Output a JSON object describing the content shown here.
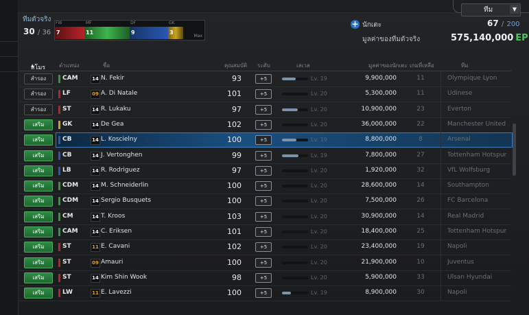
{
  "team_dropdown": {
    "label": "ทีม",
    "arrow": "▼"
  },
  "summary": {
    "title": "ทีมตัวจริง",
    "count": "30",
    "max": "/ 36"
  },
  "position_bar": {
    "headers": [
      "FW",
      "MF",
      "DF",
      "GK"
    ],
    "counts": [
      "7",
      "11",
      "9",
      "3"
    ],
    "max_label": "Max",
    "colors": {
      "FW": "#b8242a",
      "MF": "#2e9a3a",
      "DF": "#2a58b3",
      "GK": "#c9a21e"
    }
  },
  "player_add": {
    "icon": "plus-icon",
    "label": "นักเตะ"
  },
  "capacity": {
    "current": "67",
    "slash": "/",
    "max": "200"
  },
  "team_value": {
    "label": "มูลค่าของทีมตัวจริง",
    "amount": "575,140,000",
    "unit": "EP"
  },
  "columns": {
    "status": "สโมร",
    "sort_indicator": "▴",
    "position": "ตำแหน่ง",
    "name": "ชื่อ",
    "ovr": "คุณสมบัติ",
    "grade": "ระดับ",
    "level": "เลเวล",
    "value": "มูลค่าของนักเตะ",
    "games": "เกมที่เหลือ",
    "club": "ทีม"
  },
  "players": [
    {
      "status": "สำรอง",
      "type": "sub",
      "pos": "CAM",
      "pcolor": "#2e9a3a",
      "card": "14",
      "cardtype": "w",
      "name": "N. Fekir",
      "ovr": "93",
      "grade": "+5",
      "lvfill": 0.52,
      "lv": "Lv. 19",
      "value": "9,900,000",
      "games": "11",
      "club": "Olympique Lyon"
    },
    {
      "status": "สำรอง",
      "type": "sub",
      "pos": "LF",
      "pcolor": "#b8242a",
      "card": "09",
      "cardtype": "y",
      "name": "A. Di Natale",
      "ovr": "101",
      "grade": "+5",
      "lvfill": 0.0,
      "lv": "Lv. 20",
      "value": "5,300,000",
      "games": "11",
      "club": "Udinese"
    },
    {
      "status": "สำรอง",
      "type": "sub",
      "pos": "ST",
      "pcolor": "#b8242a",
      "card": "14",
      "cardtype": "w",
      "name": "R. Lukaku",
      "ovr": "97",
      "grade": "+5",
      "lvfill": 0.6,
      "lv": "Lv. 20",
      "value": "10,900,000",
      "games": "23",
      "club": "Everton"
    },
    {
      "status": "เสริม",
      "type": "start",
      "pos": "GK",
      "pcolor": "#c9a21e",
      "card": "14",
      "cardtype": "w",
      "name": "De Gea",
      "ovr": "102",
      "grade": "+5",
      "lvfill": 0.0,
      "lv": "Lv. 20",
      "value": "36,000,000",
      "games": "22",
      "club": "Manchester United"
    },
    {
      "status": "เสริม",
      "type": "start",
      "pos": "CB",
      "pcolor": "#2a58b3",
      "card": "14",
      "cardtype": "w",
      "name": "L. Koscielny",
      "ovr": "100",
      "grade": "+5",
      "lvfill": 0.55,
      "lv": "Lv. 19",
      "value": "8,800,000",
      "games": "8",
      "club": "Arsenal",
      "selected": true
    },
    {
      "status": "เสริม",
      "type": "start",
      "pos": "CB",
      "pcolor": "#2a58b3",
      "card": "14",
      "cardtype": "w",
      "name": "J. Vertonghen",
      "ovr": "99",
      "grade": "+5",
      "lvfill": 0.62,
      "lv": "Lv. 19",
      "value": "7,800,000",
      "games": "27",
      "club": "Tottenham Hotspur"
    },
    {
      "status": "เสริม",
      "type": "start",
      "pos": "LB",
      "pcolor": "#2a58b3",
      "card": "14",
      "cardtype": "w",
      "name": "R. Rodriguez",
      "ovr": "97",
      "grade": "+5",
      "lvfill": 0.0,
      "lv": "Lv. 20",
      "value": "1,920,000",
      "games": "32",
      "club": "VfL Wolfsburg"
    },
    {
      "status": "เสริม",
      "type": "start",
      "pos": "CDM",
      "pcolor": "#2e9a3a",
      "card": "14",
      "cardtype": "w",
      "name": "M. Schneiderlin",
      "ovr": "100",
      "grade": "+5",
      "lvfill": 0.0,
      "lv": "Lv. 20",
      "value": "28,600,000",
      "games": "14",
      "club": "Southampton"
    },
    {
      "status": "เสริม",
      "type": "start",
      "pos": "CDM",
      "pcolor": "#2e9a3a",
      "card": "14",
      "cardtype": "w",
      "name": "Sergio Busquets",
      "ovr": "100",
      "grade": "+5",
      "lvfill": 0.0,
      "lv": "Lv. 20",
      "value": "7,500,000",
      "games": "26",
      "club": "FC Barcelona"
    },
    {
      "status": "เสริม",
      "type": "start",
      "pos": "CM",
      "pcolor": "#2e9a3a",
      "card": "14",
      "cardtype": "w",
      "name": "T. Kroos",
      "ovr": "103",
      "grade": "+5",
      "lvfill": 0.0,
      "lv": "Lv. 20",
      "value": "30,900,000",
      "games": "14",
      "club": "Real Madrid"
    },
    {
      "status": "เสริม",
      "type": "start",
      "pos": "CAM",
      "pcolor": "#2e9a3a",
      "card": "14",
      "cardtype": "w",
      "name": "C. Eriksen",
      "ovr": "101",
      "grade": "+5",
      "lvfill": 0.0,
      "lv": "Lv. 20",
      "value": "18,400,000",
      "games": "25",
      "club": "Tottenham Hotspur"
    },
    {
      "status": "เสริม",
      "type": "start",
      "pos": "ST",
      "pcolor": "#b8242a",
      "card": "11",
      "cardtype": "y",
      "name": "E. Cavani",
      "ovr": "102",
      "grade": "+5",
      "lvfill": 0.0,
      "lv": "Lv. 20",
      "value": "23,400,000",
      "games": "19",
      "club": "Napoli"
    },
    {
      "status": "เสริม",
      "type": "start",
      "pos": "ST",
      "pcolor": "#b8242a",
      "card": "09",
      "cardtype": "y",
      "name": "Amauri",
      "ovr": "100",
      "grade": "+5",
      "lvfill": 0.0,
      "lv": "Lv. 20",
      "value": "21,900,000",
      "games": "10",
      "club": "Juventus"
    },
    {
      "status": "เสริม",
      "type": "start",
      "pos": "ST",
      "pcolor": "#b8242a",
      "card": "14",
      "cardtype": "w",
      "name": "Kim Shin Wook",
      "ovr": "98",
      "grade": "+5",
      "lvfill": 0.0,
      "lv": "Lv. 20",
      "value": "5,900,000",
      "games": "33",
      "club": "Ulsan Hyundai"
    },
    {
      "status": "เสริม",
      "type": "start",
      "pos": "LW",
      "pcolor": "#b8242a",
      "card": "11",
      "cardtype": "y",
      "name": "E. Lavezzi",
      "ovr": "100",
      "grade": "+5",
      "lvfill": 0.35,
      "lv": "Lv. 19",
      "value": "8,900,000",
      "games": "30",
      "club": "Napoli"
    }
  ]
}
